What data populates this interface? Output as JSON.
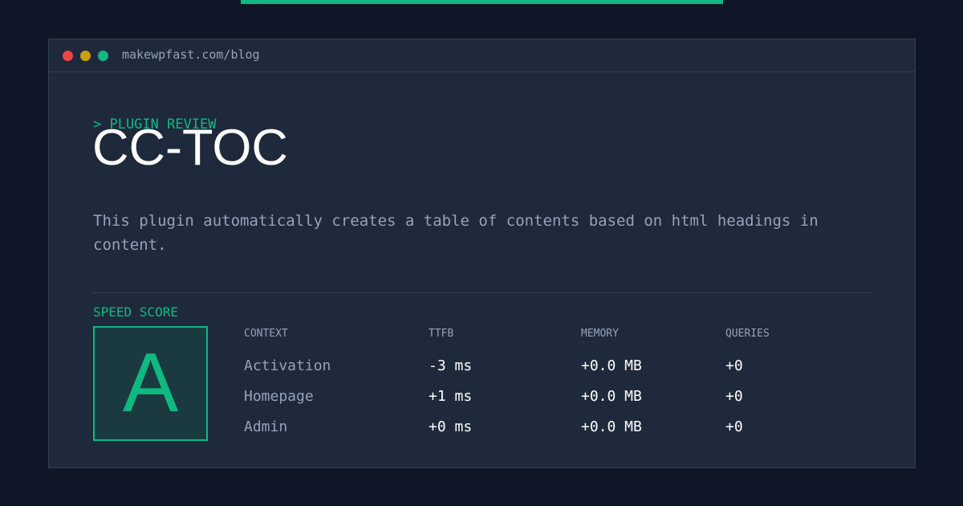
{
  "window": {
    "url": "makewpfast.com/blog"
  },
  "article": {
    "eyebrow": "> PLUGIN REVIEW",
    "title": "CC-TOC",
    "description": "This plugin automatically creates a table of contents based on html headings in content."
  },
  "speed_score": {
    "label": "SPEED SCORE",
    "grade": "A"
  },
  "metrics": {
    "headers": [
      "CONTEXT",
      "TTFB",
      "MEMORY",
      "QUERIES"
    ],
    "rows": [
      [
        "Activation",
        "-3 ms",
        "+0.0 MB",
        "+0"
      ],
      [
        "Homepage",
        "+1 ms",
        "+0.0 MB",
        "+0"
      ],
      [
        "Admin",
        "+0 ms",
        "+0.0 MB",
        "+0"
      ]
    ]
  },
  "colors": {
    "background": "#0e1628",
    "panel": "#1e293b",
    "accent": "#10b981",
    "muted_text": "#94a3b8",
    "traffic_red": "#ef4444",
    "traffic_yellow": "#eab308",
    "traffic_green": "#10b981"
  }
}
